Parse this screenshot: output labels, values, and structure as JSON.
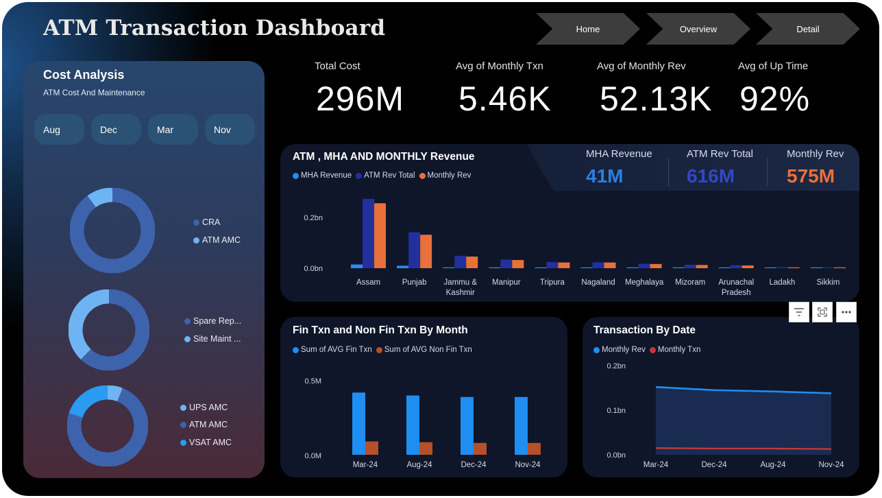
{
  "dashboard": {
    "title": "ATM Transaction Dashboard"
  },
  "nav": [
    {
      "label": "Home"
    },
    {
      "label": "Overview"
    },
    {
      "label": "Detail"
    }
  ],
  "cost_panel": {
    "title": "Cost Analysis",
    "subtitle": "ATM Cost And Maintenance",
    "months": [
      "Aug",
      "Dec",
      "Mar",
      "Nov"
    ],
    "donuts": [
      {
        "legend": [
          {
            "label": "CRA",
            "color": "#3e63ad"
          },
          {
            "label": "ATM AMC",
            "color": "#6fb4f2"
          }
        ],
        "slices": [
          0.9,
          0.1
        ]
      },
      {
        "legend": [
          {
            "label": "Spare Rep...",
            "color": "#3e63ad"
          },
          {
            "label": "Site Maint ...",
            "color": "#6fb4f2"
          }
        ],
        "slices": [
          0.62,
          0.38
        ]
      },
      {
        "legend": [
          {
            "label": "UPS AMC",
            "color": "#6fb4f2"
          },
          {
            "label": "ATM AMC",
            "color": "#3e63ad"
          },
          {
            "label": "VSAT AMC",
            "color": "#2a9bf0"
          }
        ],
        "slices": [
          0.06,
          0.74,
          0.2
        ]
      }
    ]
  },
  "kpis": [
    {
      "label": "Total Cost",
      "value": "296M"
    },
    {
      "label": "Avg of Monthly Txn",
      "value": "5.46K"
    },
    {
      "label": "Avg of Monthly Rev",
      "value": "52.13K"
    },
    {
      "label": "Avg of Up Time",
      "value": "92%"
    }
  ],
  "revenue_panel": {
    "title": "ATM , MHA AND MONTHLY Revenue",
    "kpis": [
      {
        "label": "MHA Revenue",
        "value": "41M",
        "color": "#2f7de0"
      },
      {
        "label": "ATM Rev Total",
        "value": "616M",
        "color": "#3347c4"
      },
      {
        "label": "Monthly Rev",
        "value": "575M",
        "color": "#e8703a"
      }
    ]
  },
  "fin_panel": {
    "title": "Fin Txn and Non Fin Txn By Month"
  },
  "date_panel": {
    "title": "Transaction By Date"
  },
  "toolbar": [
    {
      "icon": "filter-icon"
    },
    {
      "icon": "focus-mode-icon"
    },
    {
      "icon": "more-options-icon"
    }
  ],
  "chart_data": [
    {
      "type": "bar",
      "title": "ATM , MHA AND MONTHLY Revenue",
      "categories": [
        "Assam",
        "Punjab",
        "Jammu & Kashmir",
        "Manipur",
        "Tripura",
        "Nagaland",
        "Meghalaya",
        "Mizoram",
        "Arunachal Pradesh",
        "Ladakh",
        "Sikkim"
      ],
      "series": [
        {
          "name": "MHA Revenue",
          "color": "#2a8cf0",
          "values": [
            0.015,
            0.01,
            0.003,
            0.002,
            0.001,
            0.001,
            0.001,
            0.001,
            0.001,
            0.001,
            0.0005
          ]
        },
        {
          "name": "ATM Rev Total",
          "color": "#22309e",
          "values": [
            0.28,
            0.145,
            0.05,
            0.035,
            0.025,
            0.024,
            0.018,
            0.014,
            0.012,
            0.004,
            0.003
          ]
        },
        {
          "name": "Monthly Rev",
          "color": "#e8703a",
          "values": [
            0.262,
            0.135,
            0.047,
            0.033,
            0.023,
            0.023,
            0.017,
            0.013,
            0.011,
            0.003,
            0.002
          ]
        }
      ],
      "y_ticks": [
        "0.0bn",
        "0.2bn"
      ],
      "ylim": [
        0,
        0.3
      ],
      "unit": "bn"
    },
    {
      "type": "bar",
      "title": "Fin Txn and Non Fin Txn By Month",
      "categories": [
        "Mar-24",
        "Aug-24",
        "Dec-24",
        "Nov-24"
      ],
      "series": [
        {
          "name": "Sum of AVG Fin Txn",
          "color": "#1e8ef2",
          "values": [
            0.42,
            0.4,
            0.39,
            0.39
          ]
        },
        {
          "name": "Sum of AVG Non Fin Txn",
          "color": "#b5502a",
          "values": [
            0.09,
            0.085,
            0.08,
            0.08
          ]
        }
      ],
      "y_ticks": [
        "0.0M",
        "0.5M"
      ],
      "ylim": [
        0,
        0.5
      ],
      "unit": "M"
    },
    {
      "type": "area",
      "title": "Transaction By Date",
      "categories": [
        "Mar-24",
        "Dec-24",
        "Aug-24",
        "Nov-24"
      ],
      "series": [
        {
          "name": "Monthly Rev",
          "color": "#1e8ef2",
          "values": [
            0.152,
            0.145,
            0.142,
            0.138
          ]
        },
        {
          "name": "Monthly Txn",
          "color": "#c0393e",
          "values": [
            0.015,
            0.014,
            0.014,
            0.013
          ]
        }
      ],
      "y_ticks": [
        "0.0bn",
        "0.1bn",
        "0.2bn"
      ],
      "ylim": [
        0,
        0.2
      ],
      "unit": "bn"
    }
  ]
}
